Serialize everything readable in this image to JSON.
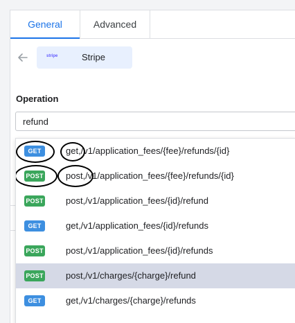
{
  "tabs": [
    {
      "label": "General",
      "active": true
    },
    {
      "label": "Advanced",
      "active": false
    }
  ],
  "connector": {
    "logo_text": "stripe",
    "name": "Stripe"
  },
  "operation": {
    "label": "Operation",
    "value": "refund"
  },
  "colors": {
    "accent": "#1a73e8",
    "get_badge": "#3d8fe0",
    "post_badge": "#3aa65b",
    "highlight_row": "#d5d9e6"
  },
  "options": [
    {
      "method": "GET",
      "text": "get,/v1/application_fees/{fee}/refunds/{id}",
      "highlighted": false
    },
    {
      "method": "POST",
      "text": "post,/v1/application_fees/{fee}/refunds/{id}",
      "highlighted": false
    },
    {
      "method": "POST",
      "text": "post,/v1/application_fees/{id}/refund",
      "highlighted": false
    },
    {
      "method": "GET",
      "text": "get,/v1/application_fees/{id}/refunds",
      "highlighted": false
    },
    {
      "method": "POST",
      "text": "post,/v1/application_fees/{id}/refunds",
      "highlighted": false
    },
    {
      "method": "POST",
      "text": "post,/v1/charges/{charge}/refund",
      "highlighted": true
    },
    {
      "method": "GET",
      "text": "get,/v1/charges/{charge}/refunds",
      "highlighted": false
    }
  ]
}
